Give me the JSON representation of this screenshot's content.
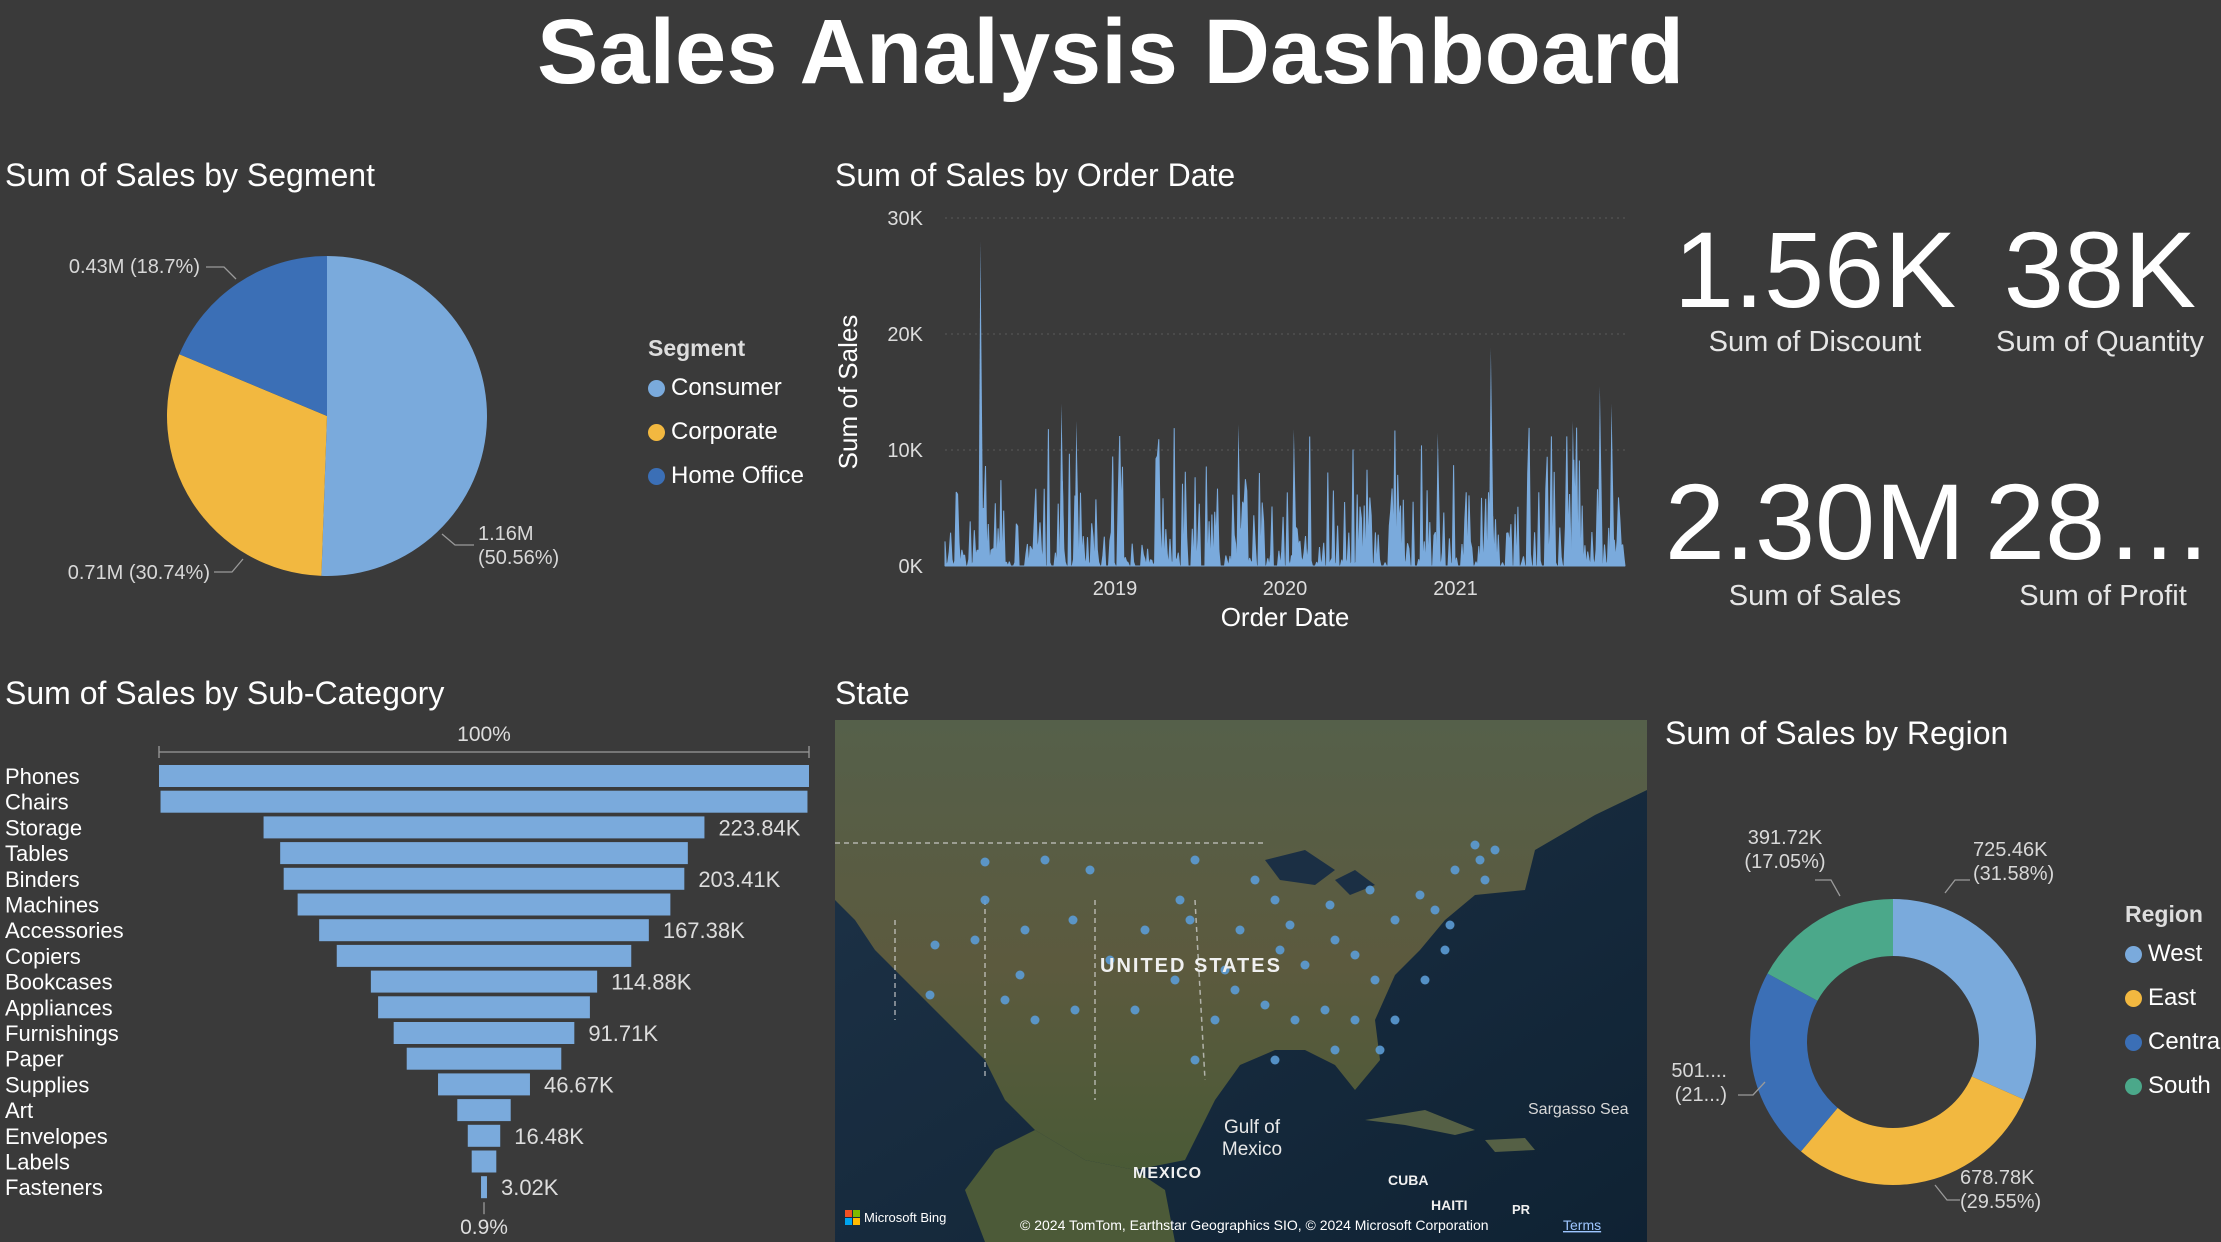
{
  "dashboard": {
    "title": "Sales Analysis Dashboard"
  },
  "colors": {
    "background": "#3a3a3a",
    "blue_light": "#7aaadc",
    "yellow": "#f2b840",
    "blue_dark": "#3b6fb6",
    "teal": "#4ba88a"
  },
  "kpis": [
    {
      "value": "1.56K",
      "label": "Sum of Discount"
    },
    {
      "value": "38K",
      "label": "Sum of Quantity"
    },
    {
      "value": "2.30M",
      "label": "Sum of Sales"
    },
    {
      "value": "28…",
      "label": "Sum of Profit"
    }
  ],
  "chart_data": [
    {
      "type": "pie",
      "title": "Sum of Sales by Segment",
      "legend_title": "Segment",
      "legend_position": "right",
      "slices": [
        {
          "label": "Consumer",
          "value": 1.16,
          "percent": 50.56,
          "data_label": "1.16M\n(50.56%)",
          "color": "#7aaadc"
        },
        {
          "label": "Corporate",
          "value": 0.71,
          "percent": 30.74,
          "data_label": "0.71M (30.74%)",
          "color": "#f2b840"
        },
        {
          "label": "Home Office",
          "value": 0.43,
          "percent": 18.7,
          "data_label": "0.43M (18.7%)",
          "color": "#3b6fb6"
        }
      ]
    },
    {
      "type": "area",
      "title": "Sum of Sales by Order Date",
      "xlabel": "Order Date",
      "ylabel": "Sum of Sales",
      "x_ticks": [
        "2019",
        "2020",
        "2021"
      ],
      "y_ticks": [
        "0K",
        "10K",
        "20K",
        "30K"
      ],
      "ylim": [
        0,
        30000
      ],
      "xlim": [
        "2018-01-01",
        "2021-12-31"
      ],
      "grid": true,
      "series": [
        {
          "color": "#7aaadc",
          "peaks": [
            {
              "date": "2018-03-18",
              "value": 28000
            },
            {
              "date": "2018-09-08",
              "value": 14000
            },
            {
              "date": "2018-10-10",
              "value": 12500
            },
            {
              "date": "2019-09-23",
              "value": 12200
            },
            {
              "date": "2020-01-20",
              "value": 11800
            },
            {
              "date": "2020-11-24",
              "value": 11500
            },
            {
              "date": "2021-03-18",
              "value": 18800
            },
            {
              "date": "2021-09-10",
              "value": 12500
            },
            {
              "date": "2021-11-07",
              "value": 15500
            },
            {
              "date": "2021-12-02",
              "value": 14000
            }
          ]
        }
      ]
    },
    {
      "type": "funnel",
      "title": "Sum of Sales by Sub-Category",
      "top_label": "100%",
      "bottom_label": "0.9%",
      "categories": [
        "Phones",
        "Chairs",
        "Storage",
        "Tables",
        "Binders",
        "Machines",
        "Accessories",
        "Copiers",
        "Bookcases",
        "Appliances",
        "Furnishings",
        "Paper",
        "Supplies",
        "Art",
        "Envelopes",
        "Labels",
        "Fasteners"
      ],
      "values": [
        330.01,
        328.45,
        223.84,
        206.97,
        203.41,
        189.24,
        167.38,
        149.53,
        114.88,
        107.53,
        91.71,
        78.48,
        46.67,
        27.12,
        16.48,
        12.49,
        3.02
      ],
      "data_labels": [
        "",
        "",
        "223.84K",
        "",
        "203.41K",
        "",
        "167.38K",
        "",
        "114.88K",
        "",
        "91.71K",
        "",
        "46.67K",
        "",
        "16.48K",
        "",
        "3.02K"
      ],
      "color": "#7aaadc"
    },
    {
      "type": "donut",
      "title": "Sum of Sales by Region",
      "legend_title": "Region",
      "legend_position": "right",
      "slices": [
        {
          "label": "West",
          "value": 725.46,
          "percent": 31.58,
          "data_label": "725.46K\n(31.58%)",
          "color": "#7aaadc"
        },
        {
          "label": "East",
          "value": 678.78,
          "percent": 29.55,
          "data_label": "678.78K\n(29.55%)",
          "color": "#f2b840"
        },
        {
          "label": "Central",
          "value": 501.24,
          "percent": 21.82,
          "data_label": "501....\n(21...)",
          "color": "#3b6fb6"
        },
        {
          "label": "South",
          "value": 391.72,
          "percent": 17.05,
          "data_label": "391.72K\n(17.05%)",
          "color": "#4ba88a"
        }
      ]
    }
  ],
  "map": {
    "title": "State",
    "labels": {
      "us": "UNITED STATES",
      "gulf": "Gulf of\nMexico",
      "mexico": "MEXICO",
      "cuba": "CUBA",
      "haiti": "HAITI",
      "pr": "PR",
      "sargasso": "Sargasso Sea"
    },
    "brand": "Microsoft Bing",
    "copyright": "© 2024 TomTom, Earthstar Geographics SIO, © 2024 Microsoft Corporation",
    "terms": "Terms",
    "dot_color": "#5b9bd5"
  }
}
